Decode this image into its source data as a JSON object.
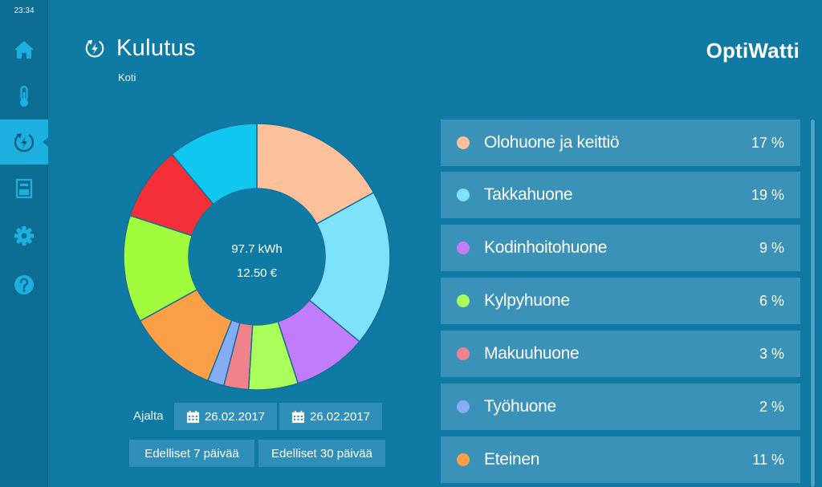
{
  "status": {
    "time": "23:34"
  },
  "sidebar": {
    "items": [
      {
        "id": "home",
        "icon": "home-icon",
        "active": false
      },
      {
        "id": "temperature",
        "icon": "thermometer-icon",
        "active": false
      },
      {
        "id": "consumption",
        "icon": "energy-icon",
        "active": true
      },
      {
        "id": "device",
        "icon": "device-icon",
        "active": false
      },
      {
        "id": "settings",
        "icon": "gear-icon",
        "active": false
      },
      {
        "id": "help",
        "icon": "help-icon",
        "active": false
      }
    ]
  },
  "header": {
    "title": "Kulutus",
    "subtitle": "Koti",
    "brand": "OptiWatti"
  },
  "summary": {
    "energy": "97.7 kWh",
    "cost": "12.50 €"
  },
  "date_controls": {
    "label": "Ajalta",
    "start_date": "26.02.2017",
    "end_date": "26.02.2017",
    "last_7_label": "Edelliset 7 päivää",
    "last_30_label": "Edelliset 30 päivää"
  },
  "rooms": [
    {
      "name": "Olohuone ja keittiö",
      "percent_label": "17 %",
      "color": "#fcc09a"
    },
    {
      "name": "Takkahuone",
      "percent_label": "19 %",
      "color": "#7ee2fb"
    },
    {
      "name": "Kodinhoitohuone",
      "percent_label": "9 %",
      "color": "#c17cfa"
    },
    {
      "name": "Kylpyhuone",
      "percent_label": "6 %",
      "color": "#aaff5a"
    },
    {
      "name": "Makuuhuone",
      "percent_label": "3 %",
      "color": "#f0828c"
    },
    {
      "name": "Työhuone",
      "percent_label": "2 %",
      "color": "#84adf6"
    },
    {
      "name": "Eteinen",
      "percent_label": "11 %",
      "color": "#fba046"
    }
  ],
  "chart_data": {
    "type": "pie",
    "donut": true,
    "slices": [
      {
        "value": 17,
        "color": "#fcc09a"
      },
      {
        "value": 19,
        "color": "#7ee2fb"
      },
      {
        "value": 9,
        "color": "#c17cfa"
      },
      {
        "value": 6,
        "color": "#aaff5a"
      },
      {
        "value": 3,
        "color": "#f0828c"
      },
      {
        "value": 2,
        "color": "#84adf6"
      },
      {
        "value": 11,
        "color": "#fba046"
      },
      {
        "value": 13,
        "color": "#a0fc3c"
      },
      {
        "value": 9,
        "color": "#f42f37"
      },
      {
        "value": 11,
        "color": "#10c8ef"
      }
    ]
  }
}
